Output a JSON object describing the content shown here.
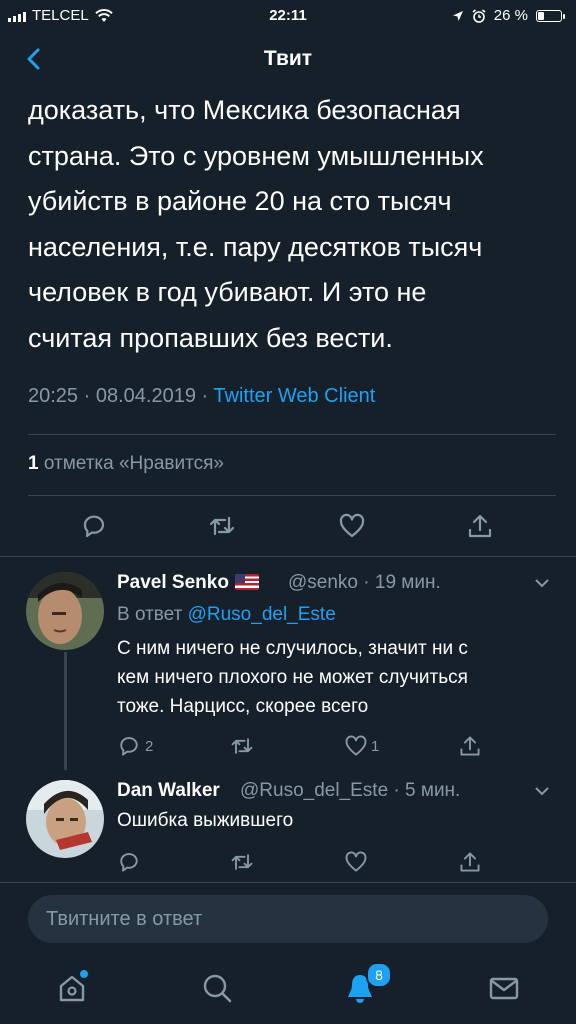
{
  "status_bar": {
    "carrier": "TELCEL",
    "time": "22:11",
    "battery": "26 %"
  },
  "header": {
    "title": "Твит"
  },
  "tweet": {
    "text_lines": [
      "доказать, что Мексика безопасная",
      "страна. Это с уровнем умышленных",
      "убийств в районе 20 на сто тысяч",
      "населения, т.е. пару десятков тысяч",
      "человек в год убивают. И это не",
      "считая пропавших без вести."
    ],
    "time": "20:25",
    "date": "08.04.2019",
    "dot": "·",
    "client": "Twitter Web Client",
    "likes_count": "1",
    "likes_label": "отметка «Нравится»"
  },
  "replies": [
    {
      "name": "Pavel Senko",
      "handle": "@senko · 19 мин.",
      "reply_to_prefix": "В ответ",
      "reply_to": "@Ruso_del_Este",
      "text_lines": [
        "С ним ничего не случилось, значит ни с",
        "кем ничего плохого не может случиться",
        "тоже. Нарцисс, скорее всего"
      ],
      "reply_count": "2",
      "like_count": "1"
    },
    {
      "name": "Dan Walker",
      "handle": "@Ruso_del_Este · 5 мин.",
      "text_lines": [
        "Ошибка выжившего"
      ]
    }
  ],
  "compose": {
    "placeholder": "Твитните в ответ"
  },
  "tabbar": {
    "items": [
      "home-icon",
      "search-icon",
      "notifications-icon",
      "messages-icon"
    ],
    "notifications_badge": "8"
  },
  "colors": {
    "background": "#15202b",
    "accent": "#1da1f2",
    "muted": "#8899a6",
    "divider": "#38444d"
  }
}
